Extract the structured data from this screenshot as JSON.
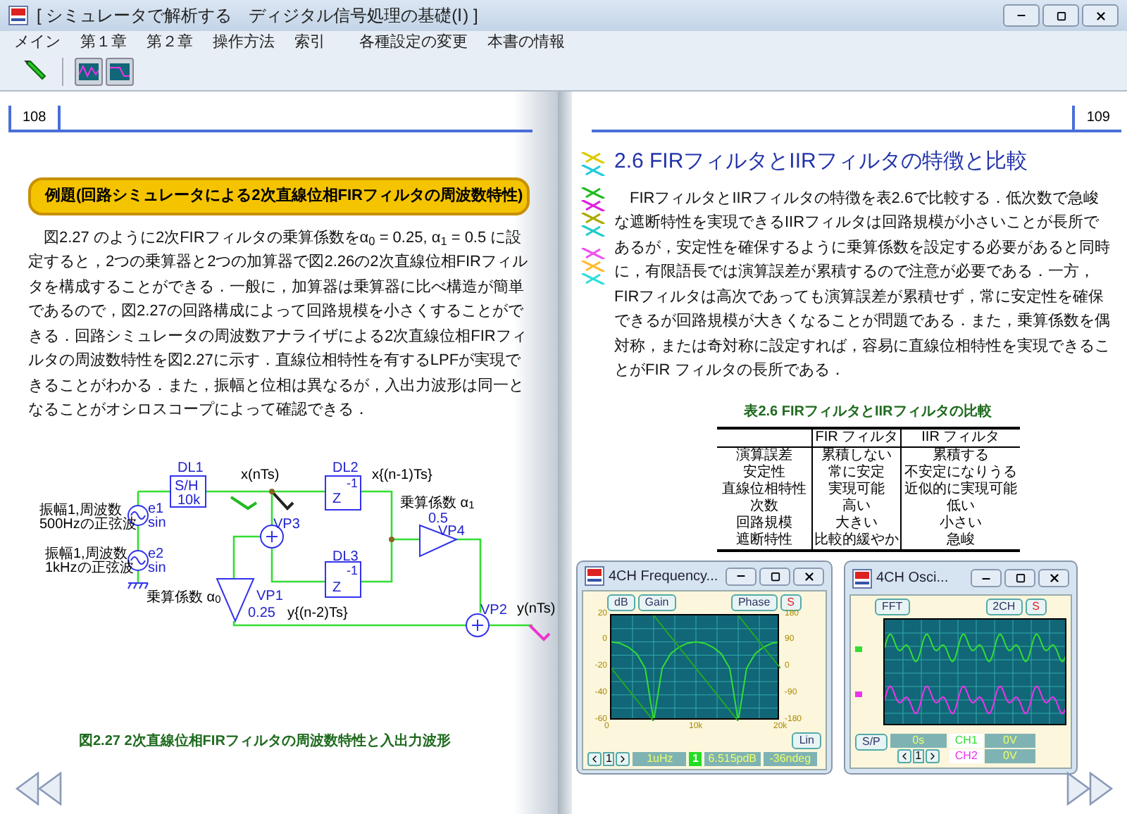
{
  "window": {
    "title": "[ シミュレータで解析する　ディジタル信号処理の基礎(Ⅰ) ]"
  },
  "menu": [
    "メイン",
    "第１章",
    "第２章",
    "操作方法",
    "索引",
    "各種設定の変更",
    "本書の情報"
  ],
  "left_page": {
    "page_number": "108",
    "example_title": "例題(回路シミュレータによる2次直線位相FIRフィルタの周波数特性)",
    "paragraph": "図2.27 のように2次FIRフィルタの乗算係数をα$_{0}$ = 0.25, α$_{1}$ = 0.5 に設定すると，2つの乗算器と2つの加算器で図2.26の2次直線位相FIRフィルタを構成することができる．一般に，加算器は乗算器に比べ構造が簡単であるので，図2.27の回路構成によって回路規模を小さくすることができる．回路シミュレータの周波数アナライザによる2次直線位相FIRフィルタの周波数特性を図2.27に示す．直線位相特性を有するLPFが実現できることがわかる．また，振幅と位相は異なるが，入出力波形は同一となることがオシロスコープによって確認できる．",
    "circuit_labels": [
      "DL1",
      "S/H",
      "10k",
      "x(nTs)",
      "DL2",
      "-1",
      "Z",
      "x{(n-1)Ts}",
      "乗算係数 α$_{1}$",
      "0.5",
      "VP4",
      "VP3",
      "DL3",
      "-1",
      "Z",
      "e1",
      "sin",
      "e2",
      "sin",
      "振幅1,周波数",
      "500Hzの正弦波",
      "振幅1,周波数",
      "1kHzの正弦波",
      "乗算係数 α$_{0}$",
      "VP1",
      "0.25",
      "y{(n-2)Ts}",
      "VP2",
      "y(nTs)"
    ],
    "caption": "図2.27 2次直線位相FIRフィルタの周波数特性と入出力波形"
  },
  "right_page": {
    "page_number": "109",
    "heading": "2.6 FIRフィルタとIIRフィルタの特徴と比較",
    "paragraph": "FIRフィルタとIIRフィルタの特徴を表2.6で比較する．低次数で急峻な遮断特性を実現できるIIRフィルタは回路規模が小さいことが長所であるが，安定性を確保するように乗算係数を設定する必要があると同時に，有限語長では演算誤差が累積するので注意が必要である．一方，FIRフィルタは高次であっても演算誤差が累積せず，常に安定性を確保できるが回路規模が大きくなることが問題である．また，乗算係数を偶対称，または奇対称に設定すれば，容易に直線位相特性を実現できることがFIR フィルタの長所である．",
    "table": {
      "caption": "表2.6 FIRフィルタとIIRフィルタの比較",
      "columns": [
        "",
        "FIR フィルタ",
        "IIR フィルタ"
      ],
      "rows": [
        [
          "演算誤差",
          "累積しない",
          "累積する"
        ],
        [
          "安定性",
          "常に安定",
          "不安定になりうる"
        ],
        [
          "直線位相特性",
          "実現可能",
          "近似的に実現可能"
        ],
        [
          "次数",
          "高い",
          "低い"
        ],
        [
          "回路規模",
          "大きい",
          "小さい"
        ],
        [
          "遮断特性",
          "比較的緩やか",
          "急峻"
        ]
      ]
    },
    "scope_windows": [
      {
        "kind": "frequency",
        "title": "4CH Frequency...",
        "left_buttons": [
          "dB",
          "Gain"
        ],
        "right_buttons": [
          "Phase",
          "S"
        ],
        "gain": {
          "chart_data": {
            "type": "line",
            "x": [
              0,
              1000,
              2000,
              3000,
              4000,
              5000,
              6000,
              7000,
              8000,
              9000,
              10000,
              11000,
              12000,
              13000,
              14000,
              15000,
              16000,
              17000,
              18000,
              19000,
              20000
            ],
            "series": [
              {
                "color": "#33dd33",
                "values": [
                  0,
                  -1,
                  -4,
                  -9,
                  -20,
                  -60,
                  -20,
                  -9,
                  -4,
                  -1,
                  0,
                  -1,
                  -4,
                  -9,
                  -20,
                  -60,
                  -20,
                  -9,
                  -4,
                  -1,
                  0
                ]
              }
            ],
            "xlim": [
              0,
              20000
            ],
            "ylim": [
              -60,
              20
            ],
            "grid": true,
            "xticks": [
              {
                "value": 0,
                "label": "0"
              },
              {
                "value": 10000,
                "label": "10k"
              },
              {
                "value": 20000,
                "label": "20k"
              }
            ],
            "yticks": [
              20,
              0,
              -20,
              -40,
              -60
            ]
          }
        },
        "phase": {
          "chart_data": {
            "type": "line",
            "x": [
              0,
              5000,
              5000,
              15000,
              15000,
              20000
            ],
            "series": [
              {
                "color": "#22aa22",
                "values": [
                  0,
                  -180,
                  180,
                  -180,
                  180,
                  0
                ]
              }
            ],
            "xlim": [
              0,
              20000
            ],
            "ylim": [
              -180,
              180
            ],
            "yticks": [
              180,
              90,
              0,
              -90,
              -180
            ]
          }
        },
        "scale_button": "Lin",
        "nav_index": "1",
        "marker": "1",
        "readouts": [
          "1uHz",
          "6.515pdB",
          "-36ndeg"
        ]
      },
      {
        "kind": "oscilloscope",
        "title": "4CH Osci...",
        "left_buttons": [
          "FFT"
        ],
        "right_buttons": [
          "2CH",
          "S"
        ],
        "mode_button": "S/P",
        "time": "0s",
        "nav_index": "1",
        "channels": [
          {
            "name": "CH1",
            "value": "0V",
            "color": "#33dd33"
          },
          {
            "name": "CH2",
            "value": "0V",
            "color": "#ee33ee"
          }
        ]
      }
    ]
  }
}
